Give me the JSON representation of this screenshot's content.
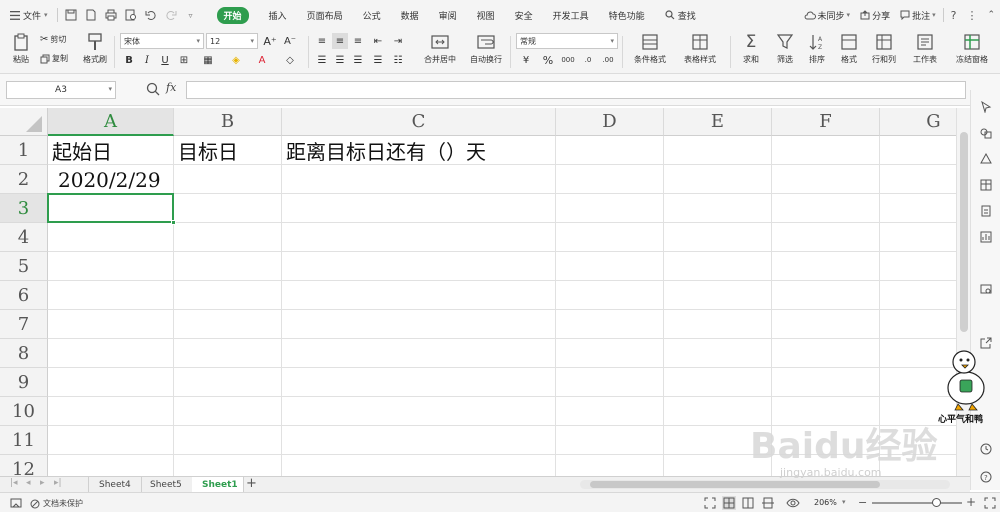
{
  "menubar": {
    "file_label": "文件",
    "tabs": [
      {
        "label": "开始",
        "active": true
      },
      {
        "label": "插入"
      },
      {
        "label": "页面布局"
      },
      {
        "label": "公式"
      },
      {
        "label": "数据"
      },
      {
        "label": "审阅"
      },
      {
        "label": "视图"
      },
      {
        "label": "安全"
      },
      {
        "label": "开发工具"
      },
      {
        "label": "特色功能"
      },
      {
        "label": "查找",
        "icon": "search-icon"
      }
    ],
    "right": {
      "sync": "未同步",
      "share": "分享",
      "comment": "批注"
    }
  },
  "ribbon": {
    "paste": "粘贴",
    "cut": "剪切",
    "copy": "复制",
    "format_painter": "格式刷",
    "font_name": "宋体",
    "font_size": "12",
    "merge_center": "合并居中",
    "wrap_text": "自动换行",
    "number_format": "常规",
    "conditional_format": "条件格式",
    "table_style": "表格样式",
    "sum": "求和",
    "filter": "筛选",
    "sort": "排序",
    "format": "格式",
    "row_col": "行和列",
    "worksheet": "工作表",
    "freeze": "冻结窗格"
  },
  "formula_bar": {
    "name_box": "A3",
    "fx": "fx",
    "value": ""
  },
  "grid": {
    "columns": [
      "A",
      "B",
      "C",
      "D",
      "E",
      "F",
      "G"
    ],
    "rows": [
      "1",
      "2",
      "3",
      "4",
      "5",
      "6",
      "7",
      "8",
      "9",
      "10",
      "11",
      "12"
    ],
    "selected_cell": "A3",
    "cells": {
      "A1": "起始日",
      "B1": "目标日",
      "C1": "距离目标日还有（）天",
      "A2": "2020/2/29"
    }
  },
  "sheets": {
    "tabs": [
      "Sheet4",
      "Sheet5",
      "Sheet1"
    ],
    "active": "Sheet1",
    "add": "+"
  },
  "status": {
    "protect": "文档未保护",
    "zoom": "206%"
  },
  "watermark": {
    "brand": "Baidu经验",
    "url": "jingyan.baidu.com",
    "mascot_text": "心平气和鸭"
  },
  "colors": {
    "accent": "#2e9d4e",
    "toolbar_bg": "#f4f4f4",
    "grid_line": "#e1e1e1"
  }
}
